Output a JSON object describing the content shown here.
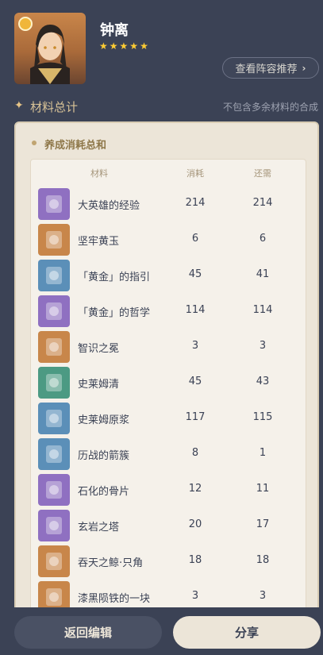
{
  "character": {
    "name": "钟离",
    "stars": [
      "★",
      "★",
      "★",
      "★",
      "★"
    ],
    "element": "geo",
    "avatar": "zhongli-avatar"
  },
  "recommend_button": {
    "label": "查看阵容推荐",
    "icon": "chevron-right-icon"
  },
  "section": {
    "title": "材料总计",
    "note": "不包含多余材料的合成"
  },
  "card": {
    "title": "养成消耗总和",
    "columns": {
      "material": "材料",
      "used": "消耗",
      "needed": "还需"
    },
    "rows": [
      {
        "name": "大英雄的经验",
        "used": "214",
        "needed": "214",
        "icon": "book-icon",
        "bg": "#8f70c1"
      },
      {
        "name": "坚牢黄玉",
        "used": "6",
        "needed": "6",
        "icon": "topaz-gem-icon",
        "bg": "#c8864a"
      },
      {
        "name": "「黄金」的指引",
        "used": "45",
        "needed": "41",
        "icon": "guide-book-icon",
        "bg": "#5b8fb8"
      },
      {
        "name": "「黄金」的哲学",
        "used": "114",
        "needed": "114",
        "icon": "philosophy-book-icon",
        "bg": "#8f70c1"
      },
      {
        "name": "智识之冕",
        "used": "3",
        "needed": "3",
        "icon": "crown-icon",
        "bg": "#c8864a"
      },
      {
        "name": "史莱姆清",
        "used": "45",
        "needed": "43",
        "icon": "slime-condensate-icon",
        "bg": "#4c9a83"
      },
      {
        "name": "史莱姆原浆",
        "used": "117",
        "needed": "115",
        "icon": "slime-concentrate-icon",
        "bg": "#5b8fb8"
      },
      {
        "name": "历战的箭簇",
        "used": "8",
        "needed": "1",
        "icon": "arrowhead-icon",
        "bg": "#5b8fb8"
      },
      {
        "name": "石化的骨片",
        "used": "12",
        "needed": "11",
        "icon": "bone-shard-icon",
        "bg": "#8f70c1"
      },
      {
        "name": "玄岩之塔",
        "used": "20",
        "needed": "17",
        "icon": "basalt-pillar-icon",
        "bg": "#8f70c1"
      },
      {
        "name": "吞天之鲸·只角",
        "used": "18",
        "needed": "18",
        "icon": "whale-horn-icon",
        "bg": "#c8864a"
      },
      {
        "name": "漆黑陨铁的一块",
        "used": "3",
        "needed": "3",
        "icon": "meteorite-icon",
        "bg": "#c8864a"
      }
    ]
  },
  "footer": {
    "back_label": "返回编辑",
    "share_label": "分享"
  },
  "colors": {
    "background": "#3b4255",
    "card": "#ece5d8",
    "accent": "#d9c397",
    "star": "#ffcc33"
  }
}
